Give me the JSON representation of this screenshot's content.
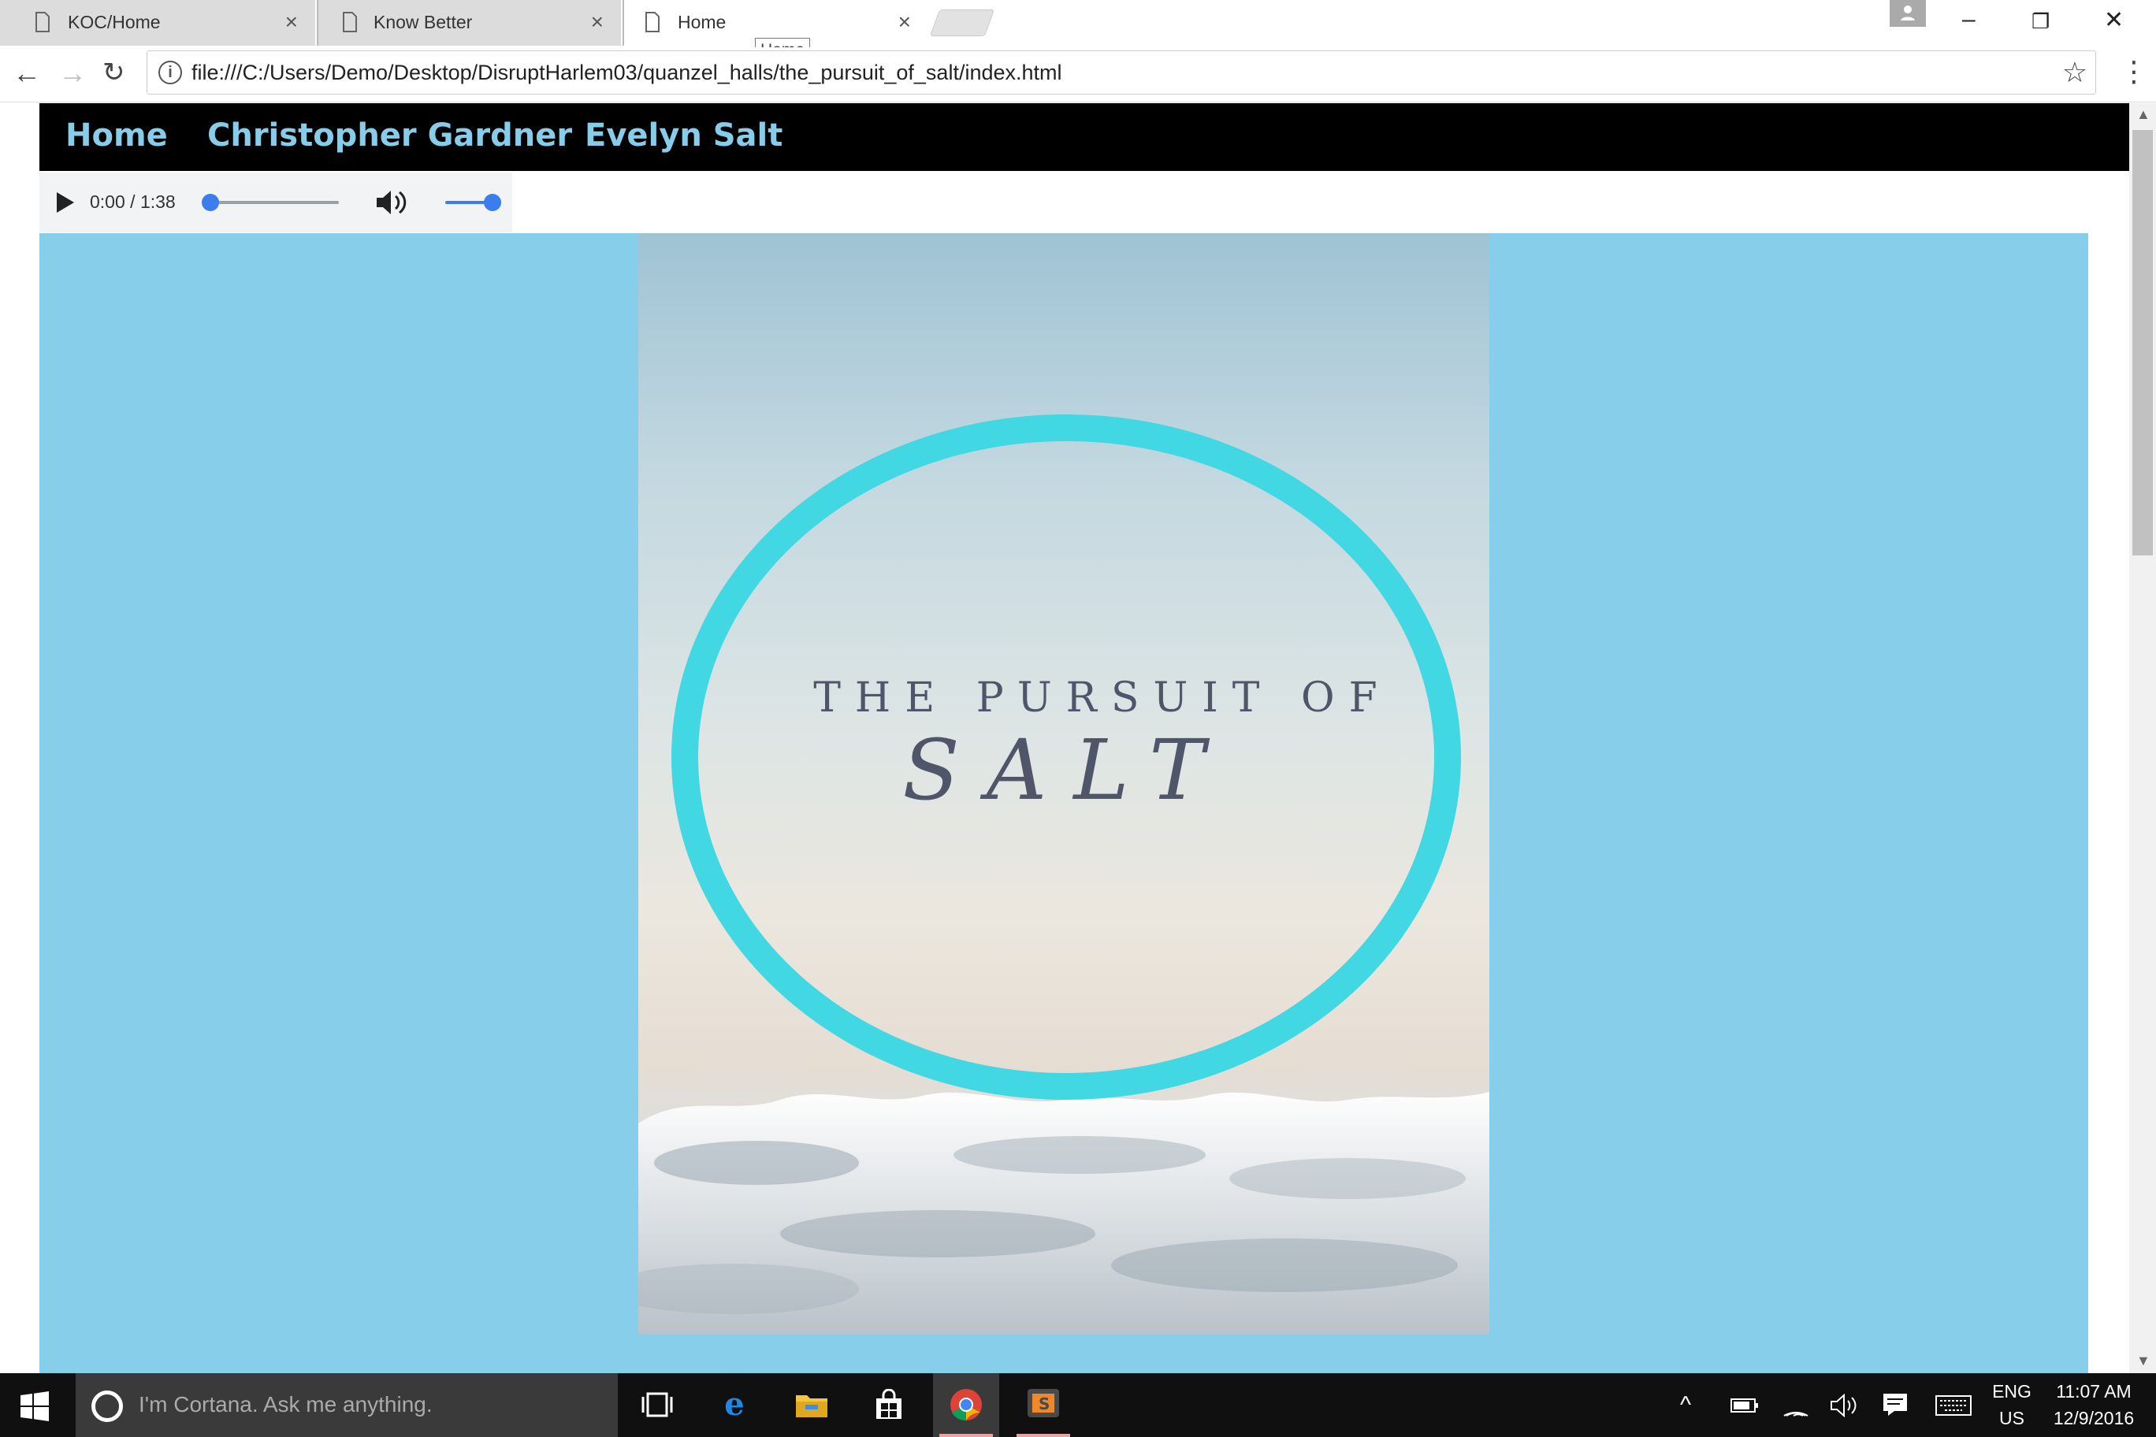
{
  "browser": {
    "tabs": [
      {
        "title": "KOC/Home",
        "active": false
      },
      {
        "title": "Know Better",
        "active": false
      },
      {
        "title": "Home",
        "active": true
      }
    ],
    "tooltip": "Home",
    "url": "file:///C:/Users/Demo/Desktop/DisruptHarlem03/quanzel_halls/the_pursuit_of_salt/index.html"
  },
  "page": {
    "nav": {
      "links": [
        "Home",
        "Christopher Gardner",
        "Evelyn Salt"
      ],
      "link_color": "#87cdea",
      "background": "#000000"
    },
    "audio": {
      "current_time": "0:00",
      "separator": "/",
      "duration": "1:38",
      "progress": 0,
      "volume": 1.0
    },
    "hero": {
      "background": "#87ceea",
      "poster": {
        "line1": "THE PURSUIT OF",
        "line2": "SALT",
        "circle_color": "#41d7e3",
        "text_color": "#50566a"
      }
    }
  },
  "taskbar": {
    "search_placeholder": "I'm Cortana. Ask me anything.",
    "apps": [
      "task-view-icon",
      "edge-icon",
      "file-explorer-icon",
      "store-icon",
      "chrome-icon",
      "sublime-text-icon"
    ],
    "language": "ENG",
    "region": "US",
    "time": "11:07 AM",
    "date": "12/9/2016"
  }
}
